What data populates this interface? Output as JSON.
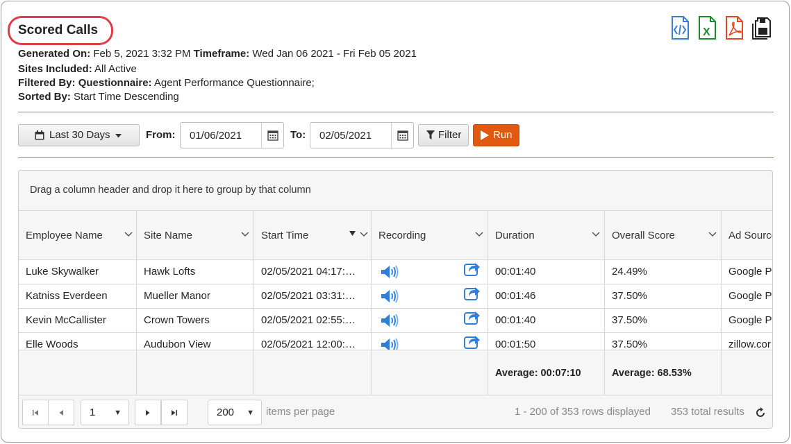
{
  "report": {
    "title": "Scored Calls",
    "generated_on_label": "Generated On:",
    "generated_on_value": "Feb 5, 2021 3:32 PM",
    "timeframe_label": "Timeframe:",
    "timeframe_value": "Wed Jan 06 2021 - Fri Feb 05 2021",
    "sites_label": "Sites Included:",
    "sites_value": "All Active",
    "filtered_label": "Filtered By:",
    "questionnaire_label": "Questionnaire:",
    "questionnaire_value": "Agent Performance Questionnaire;",
    "sorted_label": "Sorted By:",
    "sorted_value": "Start Time Descending"
  },
  "export_icons": [
    "code-export-icon",
    "excel-export-icon",
    "pdf-export-icon",
    "save-icon"
  ],
  "colors": {
    "accent_run": "#e0590f",
    "title_highlight": "#e23b4a",
    "rule": "#c8733a",
    "excel": "#1e8a2e",
    "pdf": "#e8451e",
    "code": "#3a7bd5",
    "audio": "#2f7fd8"
  },
  "toolbar": {
    "range_label": "Last 30 Days",
    "from_label": "From:",
    "from_value": "01/06/2021",
    "to_label": "To:",
    "to_value": "02/05/2021",
    "filter_label": "Filter",
    "run_label": "Run"
  },
  "grid": {
    "group_hint": "Drag a column header and drop it here to group by that column",
    "columns": [
      "Employee Name",
      "Site Name",
      "Start Time",
      "Recording",
      "Duration",
      "Overall Score",
      "Ad Source"
    ],
    "rows": [
      {
        "employee": "Luke Skywalker",
        "site": "Hawk Lofts",
        "start": "02/05/2021 04:17:…",
        "duration": "00:01:40",
        "score": "24.49%",
        "ad": "Google P"
      },
      {
        "employee": "Katniss Everdeen",
        "site": "Mueller Manor",
        "start": "02/05/2021 03:31:…",
        "duration": "00:01:46",
        "score": "37.50%",
        "ad": "Google P"
      },
      {
        "employee": "Kevin McCallister",
        "site": "Crown Towers",
        "start": "02/05/2021 02:55:…",
        "duration": "00:01:40",
        "score": "37.50%",
        "ad": "Google P"
      },
      {
        "employee": "Elle Woods",
        "site": "Audubon View",
        "start": "02/05/2021 12:00:…",
        "duration": "00:01:50",
        "score": "37.50%",
        "ad": "zillow.cor"
      }
    ],
    "footer": {
      "duration_avg": "Average: 00:07:10",
      "score_avg": "Average: 68.53%"
    }
  },
  "pager": {
    "page": "1",
    "page_size": "200",
    "items_per_page": "items per page",
    "rows_displayed": "1 - 200 of 353 rows displayed",
    "total_results": "353 total results"
  }
}
